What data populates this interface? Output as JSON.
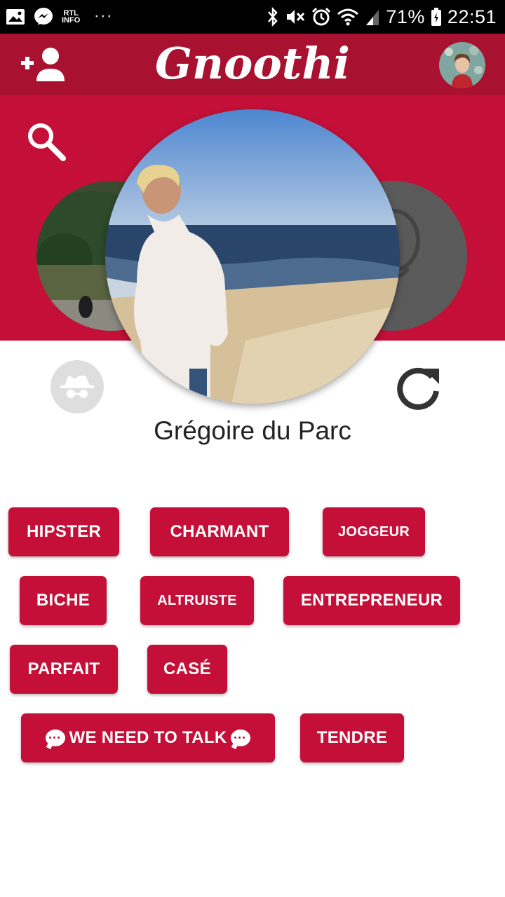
{
  "status_bar": {
    "rtl_top": "RTL",
    "rtl_bottom": "INFO",
    "more": "···",
    "battery": "71%",
    "time": "22:51"
  },
  "app_bar": {
    "logo": "Gnoothi",
    "add_user_icon": "person-add-icon",
    "avatar_icon": "user-avatar"
  },
  "profile": {
    "name": "Grégoire du Parc",
    "search_icon": "search-icon",
    "incognito_icon": "incognito-icon",
    "refresh_icon": "refresh-icon"
  },
  "tags": [
    {
      "label": "HIPSTER"
    },
    {
      "label": "CHARMANT"
    },
    {
      "label": "JOGGEUR"
    },
    {
      "label": "BICHE"
    },
    {
      "label": "ALTRUISTE"
    },
    {
      "label": "ENTREPRENEUR"
    },
    {
      "label": "PARFAIT"
    },
    {
      "label": "CASÉ"
    },
    {
      "label": "WE NEED TO TALK"
    },
    {
      "label": "TENDRE"
    }
  ],
  "colors": {
    "app_bar": "#a8112f",
    "hero": "#c41038",
    "tag": "#c41038"
  }
}
